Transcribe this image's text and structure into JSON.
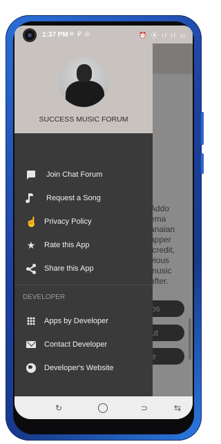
{
  "status_bar": {
    "time": "1:37 PM",
    "left_icons": "≋ ₽ ◎",
    "right_icons": "⏰ ⦿ ıl ıl ▭"
  },
  "drawer": {
    "header_title": "SUCCESS MUSIC FORUM",
    "items": [
      {
        "icon": "chat-icon",
        "label": "Join Chat Forum"
      },
      {
        "icon": "music-note-icon",
        "label": "Request a Song"
      },
      {
        "icon": "touch-icon",
        "label": "Privacy Policy"
      },
      {
        "icon": "star-icon",
        "label": "Rate this App"
      },
      {
        "icon": "share-icon",
        "label": "Share this App"
      }
    ],
    "developer_section_title": "DEVELOPER",
    "developer_items": [
      {
        "icon": "apps-grid-icon",
        "label": "Apps by Developer"
      },
      {
        "icon": "mail-icon",
        "label": "Contact Developer"
      },
      {
        "icon": "globe-icon",
        "label": "Developer's Website"
      }
    ]
  },
  "background_app": {
    "body_text": "Addo\nema\nanaian\napper\n credit,\nvious\nmusic\nafter.",
    "button_1": "os",
    "button_2": "ut",
    "button_3": "e"
  },
  "colors": {
    "drawer_bg": "#3a3a3a",
    "header_bg": "#c9c3c0",
    "phone_frame": "#1f3f9e"
  }
}
